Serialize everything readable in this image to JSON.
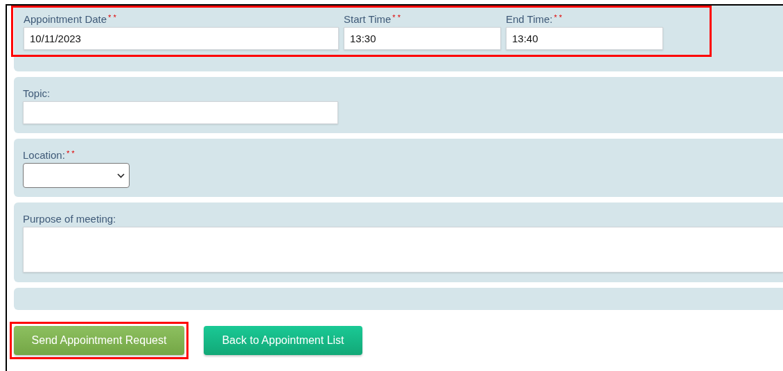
{
  "time_row": {
    "highlighted": true,
    "fields": [
      {
        "label": "Appointment Date",
        "required_mark": "* *",
        "value": "10/11/2023",
        "kind": "date"
      },
      {
        "label": "Start Time",
        "required_mark": "* *",
        "value": "13:30",
        "kind": "time"
      },
      {
        "label": "End Time:",
        "required_mark": "* *",
        "value": "13:40",
        "kind": "time"
      }
    ]
  },
  "topic": {
    "label": "Topic:"
  },
  "location": {
    "label": "Location:",
    "required_mark": "* *"
  },
  "purpose": {
    "label": "Purpose of meeting:"
  },
  "buttons": [
    {
      "label": "Send Appointment Request",
      "kind": "primary",
      "highlighted": true
    },
    {
      "label": "Back to Appointment List",
      "kind": "secondary",
      "highlighted": false
    }
  ]
}
